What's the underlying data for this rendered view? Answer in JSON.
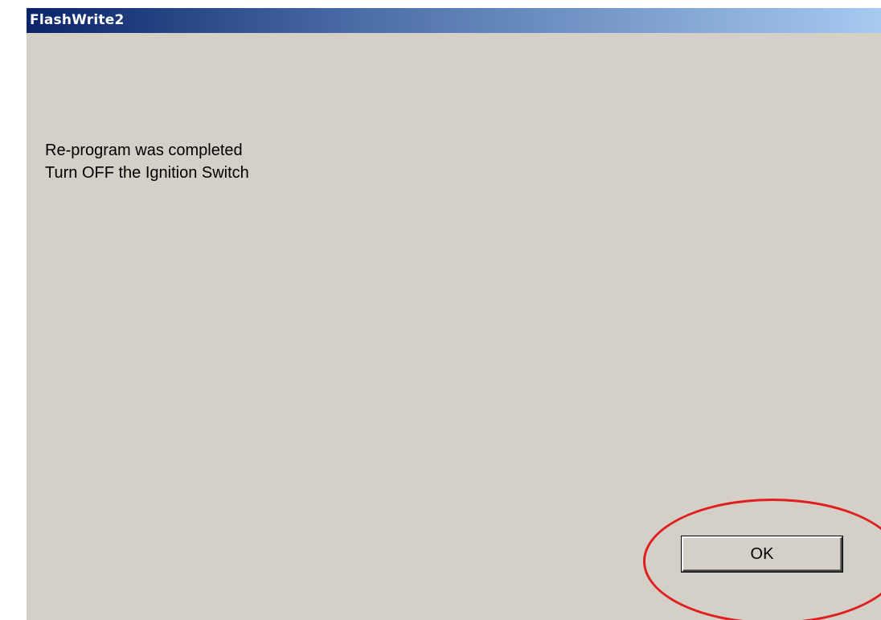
{
  "window": {
    "title": "FlashWrite2"
  },
  "message": {
    "line1": "Re-program was completed",
    "line2": "Turn OFF the Ignition Switch"
  },
  "buttons": {
    "ok_label": "OK"
  },
  "annotation": {
    "highlight_color": "#e02020",
    "shape": "ellipse",
    "target": "ok-button"
  }
}
